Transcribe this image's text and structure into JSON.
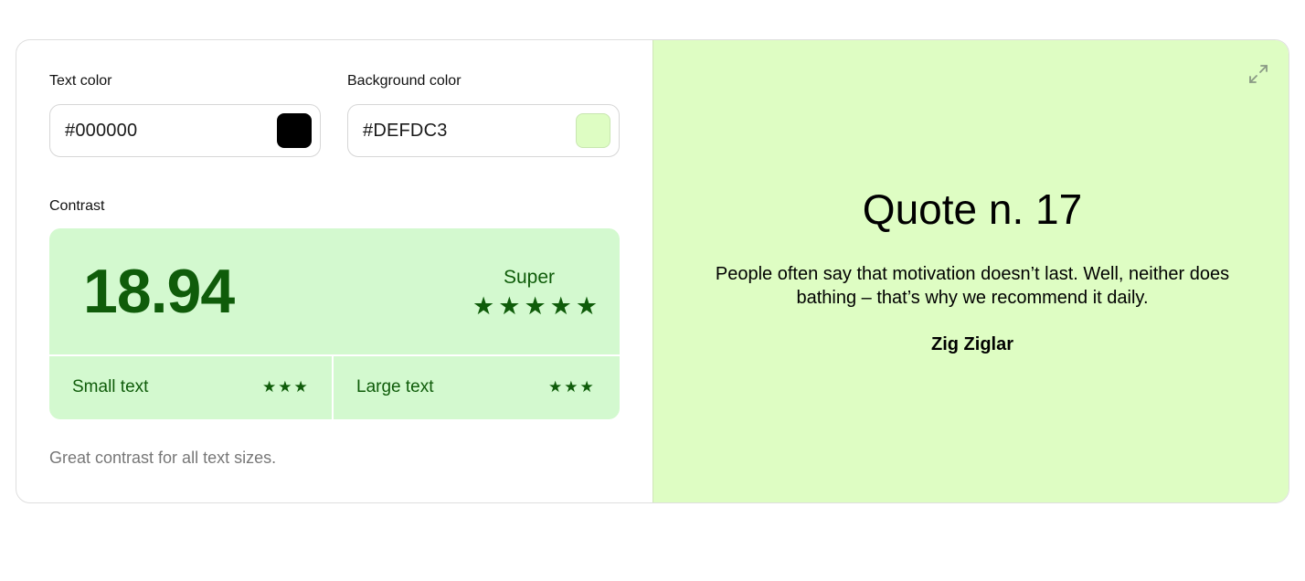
{
  "text_color": {
    "label": "Text color",
    "value": "#000000",
    "swatch": "#000000"
  },
  "background_color": {
    "label": "Background color",
    "value": "#DEFDC3",
    "swatch": "#DEFDC3"
  },
  "contrast": {
    "label": "Contrast",
    "ratio": "18.94",
    "rating": "Super",
    "rating_stars": 5,
    "small_text": {
      "label": "Small text",
      "stars": 3
    },
    "large_text": {
      "label": "Large text",
      "stars": 3
    },
    "hint": "Great contrast for all text sizes.",
    "accent_color": "#0F5C0A",
    "box_color": "#D3F9CF"
  },
  "preview": {
    "title": "Quote n. 17",
    "quote": "People often say that motivation doesn’t last. Well, neither does bathing – that’s why we recommend it daily.",
    "author": "Zig Ziglar",
    "expand_icon": "expand-icon"
  }
}
